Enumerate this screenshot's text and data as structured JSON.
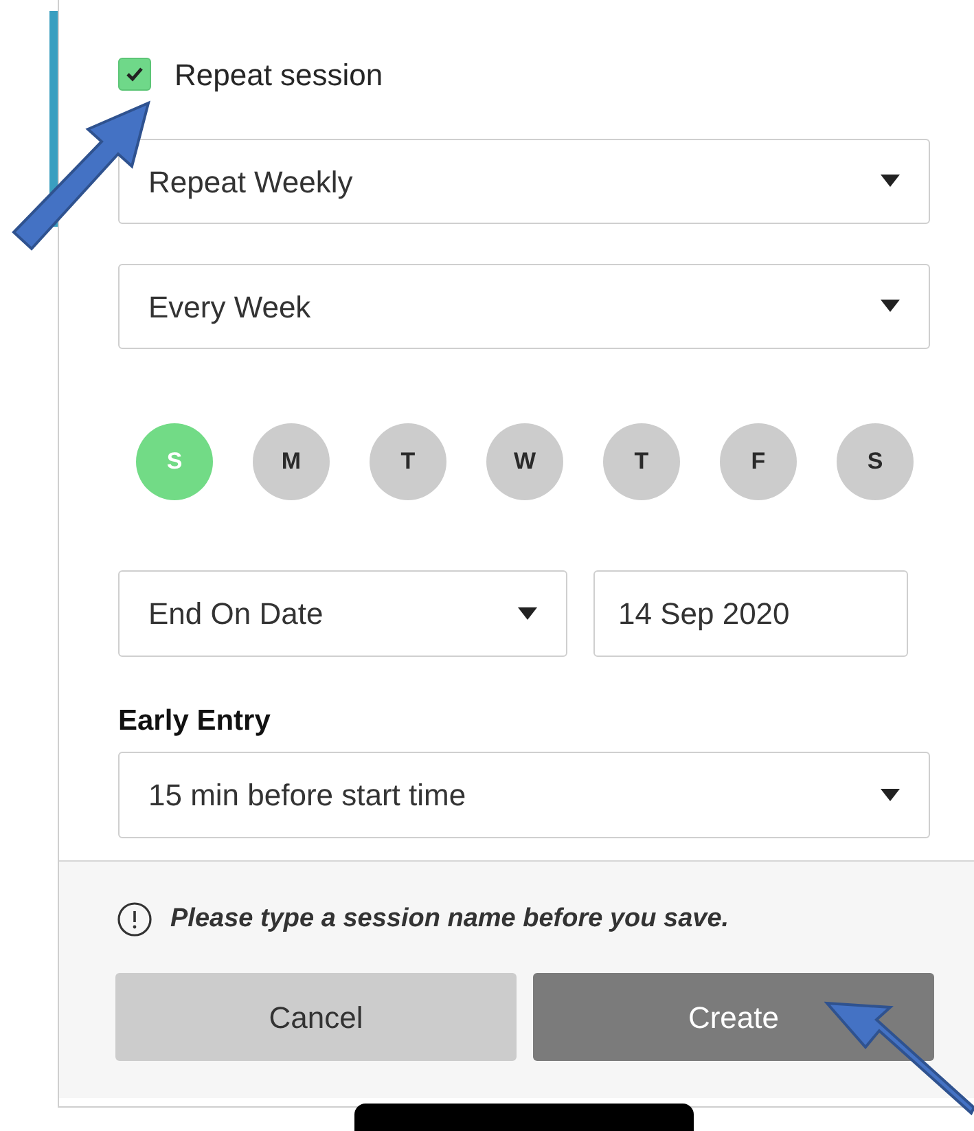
{
  "repeat_session": {
    "label": "Repeat session",
    "checked": true
  },
  "frequency": {
    "value": "Repeat Weekly"
  },
  "interval": {
    "value": "Every Week"
  },
  "days": [
    {
      "label": "S",
      "selected": true
    },
    {
      "label": "M",
      "selected": false
    },
    {
      "label": "T",
      "selected": false
    },
    {
      "label": "W",
      "selected": false
    },
    {
      "label": "T",
      "selected": false
    },
    {
      "label": "F",
      "selected": false
    },
    {
      "label": "S",
      "selected": false
    }
  ],
  "end": {
    "type": "End On Date",
    "date": "14 Sep 2020"
  },
  "early_entry": {
    "label": "Early Entry",
    "value": "15 min before start time"
  },
  "notice": "Please type a session name before you save.",
  "buttons": [
    {
      "label": "Cancel",
      "kind": "secondary"
    },
    {
      "label": "Create",
      "kind": "primary"
    }
  ]
}
